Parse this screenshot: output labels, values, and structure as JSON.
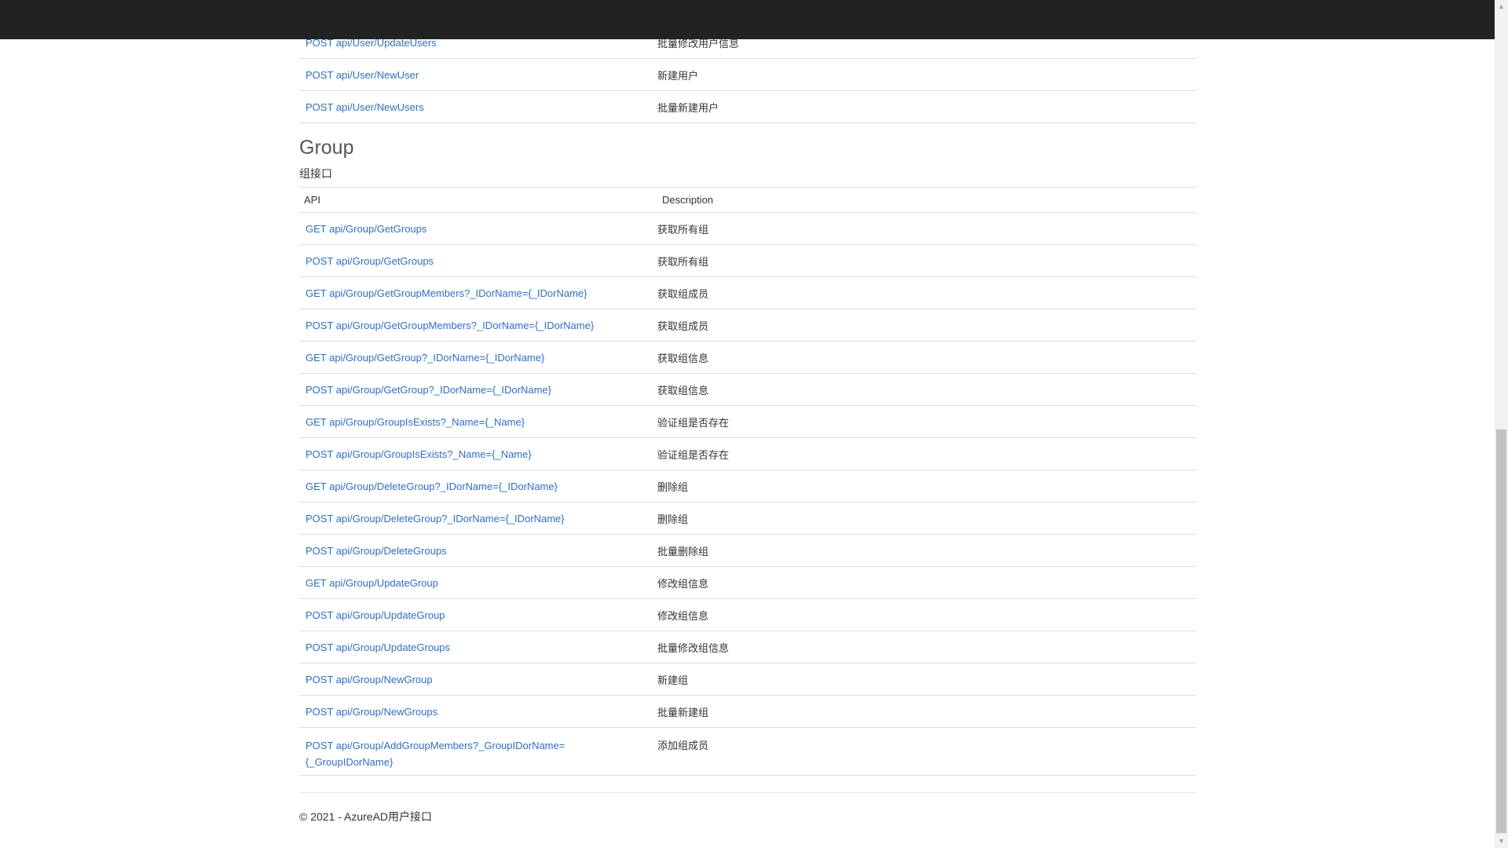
{
  "user_rows": [
    {
      "api": "POST api/User/UpdateUsers",
      "desc": "批量修改用户信息"
    },
    {
      "api": "POST api/User/NewUser",
      "desc": "新建用户"
    },
    {
      "api": "POST api/User/NewUsers",
      "desc": "批量新建用户"
    }
  ],
  "group": {
    "title": "Group",
    "subtitle": "组接口",
    "columns": {
      "api": "API",
      "desc": "Description"
    },
    "rows": [
      {
        "api": "GET api/Group/GetGroups",
        "desc": "获取所有组"
      },
      {
        "api": "POST api/Group/GetGroups",
        "desc": "获取所有组"
      },
      {
        "api": "GET api/Group/GetGroupMembers?_IDorName={_IDorName}",
        "desc": "获取组成员"
      },
      {
        "api": "POST api/Group/GetGroupMembers?_IDorName={_IDorName}",
        "desc": "获取组成员"
      },
      {
        "api": "GET api/Group/GetGroup?_IDorName={_IDorName}",
        "desc": "获取组信息"
      },
      {
        "api": "POST api/Group/GetGroup?_IDorName={_IDorName}",
        "desc": "获取组信息"
      },
      {
        "api": "GET api/Group/GroupIsExists?_Name={_Name}",
        "desc": "验证组是否存在"
      },
      {
        "api": "POST api/Group/GroupIsExists?_Name={_Name}",
        "desc": "验证组是否存在"
      },
      {
        "api": "GET api/Group/DeleteGroup?_IDorName={_IDorName}",
        "desc": "删除组"
      },
      {
        "api": "POST api/Group/DeleteGroup?_IDorName={_IDorName}",
        "desc": "删除组"
      },
      {
        "api": "POST api/Group/DeleteGroups",
        "desc": "批量删除组"
      },
      {
        "api": "GET api/Group/UpdateGroup",
        "desc": "修改组信息"
      },
      {
        "api": "POST api/Group/UpdateGroup",
        "desc": "修改组信息"
      },
      {
        "api": "POST api/Group/UpdateGroups",
        "desc": "批量修改组信息"
      },
      {
        "api": "POST api/Group/NewGroup",
        "desc": "新建组"
      },
      {
        "api": "POST api/Group/NewGroups",
        "desc": "批量新建组"
      }
    ],
    "last_row": {
      "api_line1": "POST api/Group/AddGroupMembers?_GroupIDorName=",
      "api_line2": "{_GroupIDorName}",
      "desc": "添加组成员"
    }
  },
  "footer": {
    "text": "© 2021 - AzureAD用户接口"
  },
  "colors": {
    "link": "#2a6fc9",
    "topbar": "#222222",
    "text": "#333333"
  }
}
